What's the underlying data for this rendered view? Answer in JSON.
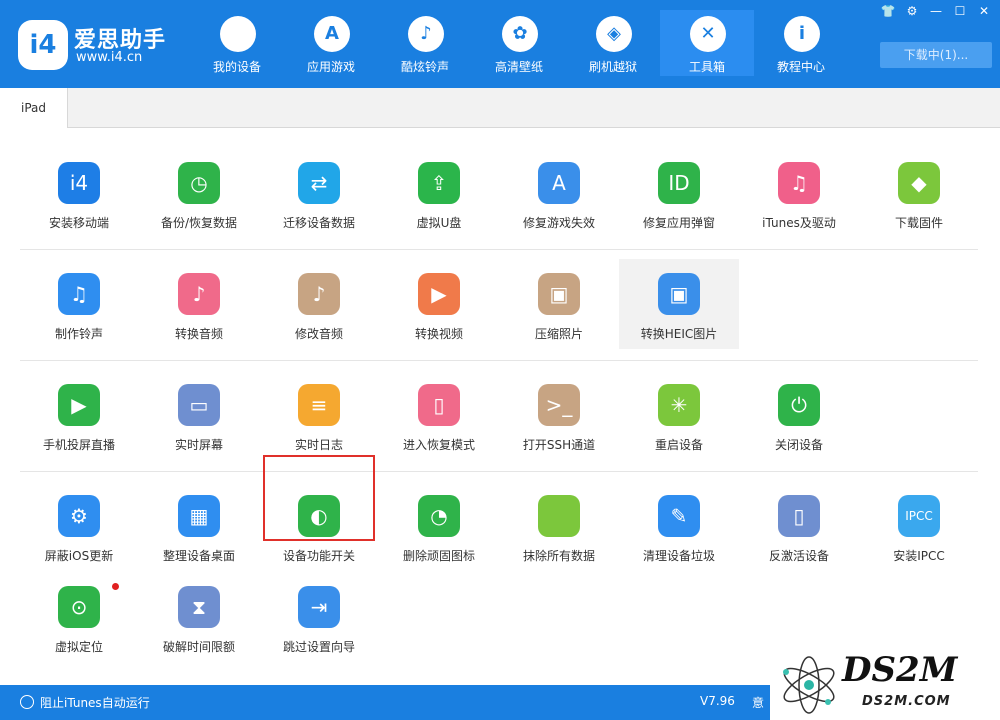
{
  "header": {
    "logo_mark": "i4",
    "logo_title": "爱思助手",
    "logo_url": "www.i4.cn",
    "nav": [
      {
        "label": "我的设备",
        "icon": "apple-icon",
        "glyph": ""
      },
      {
        "label": "应用游戏",
        "icon": "app-store-icon",
        "glyph": "A"
      },
      {
        "label": "酷炫铃声",
        "icon": "bell-icon",
        "glyph": "♪"
      },
      {
        "label": "高清壁纸",
        "icon": "flower-icon",
        "glyph": "✿"
      },
      {
        "label": "刷机越狱",
        "icon": "dropbox-icon",
        "glyph": "◈"
      },
      {
        "label": "工具箱",
        "icon": "tools-icon",
        "glyph": "✕"
      },
      {
        "label": "教程中心",
        "icon": "info-icon",
        "glyph": "i"
      }
    ],
    "active_nav": "工具箱",
    "download_label": "下载中(1)...",
    "window_buttons": [
      "shirt-icon",
      "gear-icon",
      "minimize-icon",
      "maximize-icon",
      "close-icon"
    ]
  },
  "tabs": [
    {
      "label": "iPad"
    }
  ],
  "tools": [
    {
      "label": "安装移动端",
      "icon": "i4-icon",
      "color": "#1e7ee6",
      "glyph": "i4"
    },
    {
      "label": "备份/恢复数据",
      "icon": "backup-clock-icon",
      "color": "#2fb34a",
      "glyph": "◷"
    },
    {
      "label": "迁移设备数据",
      "icon": "migrate-icon",
      "color": "#21a6e8",
      "glyph": "⇄"
    },
    {
      "label": "虚拟U盘",
      "icon": "usb-icon",
      "color": "#2bb54b",
      "glyph": "⇪"
    },
    {
      "label": "修复游戏失效",
      "icon": "app-store-repair-icon",
      "color": "#3a8fea",
      "glyph": "A"
    },
    {
      "label": "修复应用弹窗",
      "icon": "apple-id-icon",
      "color": "#2fb34a",
      "glyph": "ID"
    },
    {
      "label": "iTunes及驱动",
      "icon": "itunes-icon",
      "color": "#f0608a",
      "glyph": "♫"
    },
    {
      "label": "下载固件",
      "icon": "cube-icon",
      "color": "#7cc73c",
      "glyph": "◆"
    },
    {
      "label": "制作铃声",
      "icon": "bell-plus-icon",
      "color": "#2f8ef0",
      "glyph": "♫"
    },
    {
      "label": "转换音频",
      "icon": "music-note-icon",
      "color": "#f06a8a",
      "glyph": "♪"
    },
    {
      "label": "修改音频",
      "icon": "music-edit-icon",
      "color": "#c7a483",
      "glyph": "♪"
    },
    {
      "label": "转换视频",
      "icon": "play-icon",
      "color": "#f07a4a",
      "glyph": "▶"
    },
    {
      "label": "压缩照片",
      "icon": "photo-icon",
      "color": "#c7a483",
      "glyph": "▣"
    },
    {
      "label": "转换HEIC图片",
      "icon": "heic-image-icon",
      "color": "#3a8fea",
      "glyph": "▣"
    },
    {
      "label": "手机投屏直播",
      "icon": "screen-cast-icon",
      "color": "#2fb34a",
      "glyph": "▶"
    },
    {
      "label": "实时屏幕",
      "icon": "monitor-icon",
      "color": "#6f8fd0",
      "glyph": "▭"
    },
    {
      "label": "实时日志",
      "icon": "log-document-icon",
      "color": "#f5a830",
      "glyph": "≡"
    },
    {
      "label": "进入恢复模式",
      "icon": "recovery-phone-icon",
      "color": "#f06a8a",
      "glyph": "▯"
    },
    {
      "label": "打开SSH通道",
      "icon": "terminal-icon",
      "color": "#c7a483",
      "glyph": ">_"
    },
    {
      "label": "重启设备",
      "icon": "restart-icon",
      "color": "#7cc73c",
      "glyph": "✳"
    },
    {
      "label": "关闭设备",
      "icon": "power-icon",
      "color": "#2fb34a",
      "glyph": "⏻"
    },
    {
      "label": "屏蔽iOS更新",
      "icon": "block-update-icon",
      "color": "#2f8ef0",
      "glyph": "⚙"
    },
    {
      "label": "整理设备桌面",
      "icon": "grid-icon",
      "color": "#2f8ef0",
      "glyph": "▦"
    },
    {
      "label": "设备功能开关",
      "icon": "toggle-icon",
      "color": "#2fb34a",
      "glyph": "◐"
    },
    {
      "label": "删除顽固图标",
      "icon": "pie-icon",
      "color": "#2fb34a",
      "glyph": "◔"
    },
    {
      "label": "抹除所有数据",
      "icon": "apple-erase-icon",
      "color": "#7cc73c",
      "glyph": ""
    },
    {
      "label": "清理设备垃圾",
      "icon": "broom-icon",
      "color": "#2f8ef0",
      "glyph": "✎"
    },
    {
      "label": "反激活设备",
      "icon": "tablet-icon",
      "color": "#6f8fd0",
      "glyph": "▯"
    },
    {
      "label": "安装IPCC",
      "icon": "ipcc-icon",
      "color": "#3aa8ee",
      "glyph": "IPCC"
    },
    {
      "label": "虚拟定位",
      "icon": "location-pin-icon",
      "color": "#2fb34a",
      "glyph": "⊙"
    },
    {
      "label": "破解时间限额",
      "icon": "hourglass-icon",
      "color": "#6f8fd0",
      "glyph": "⧗"
    },
    {
      "label": "跳过设置向导",
      "icon": "skip-setup-icon",
      "color": "#3a8fea",
      "glyph": "⇥"
    }
  ],
  "footer": {
    "itunes_toggle_label": "阻止iTunes自动运行",
    "version": "V7.96",
    "feedback_label": "意"
  },
  "watermark": {
    "title": "DS2M",
    "url": "DS2M.COM"
  }
}
